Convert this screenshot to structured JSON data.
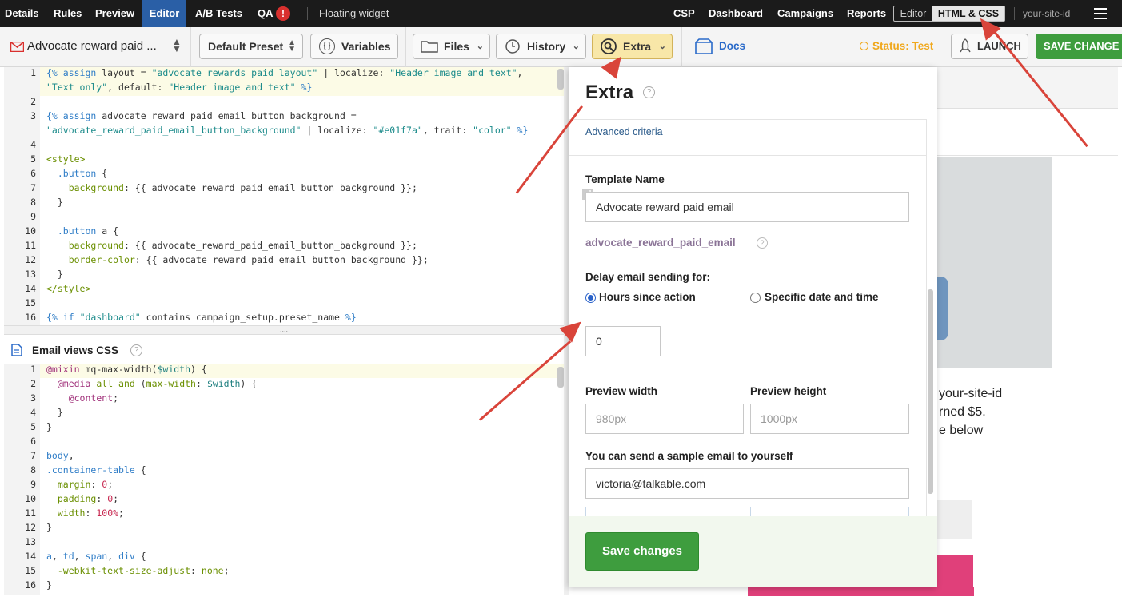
{
  "topbar": {
    "tabs": [
      "Details",
      "Rules",
      "Preview",
      "Editor",
      "A/B Tests",
      "QA"
    ],
    "qa_badge": "!",
    "widget": "Floating widget",
    "right_links": [
      "CSP",
      "Dashboard",
      "Campaigns",
      "Reports"
    ],
    "mode_editor": "Editor",
    "mode_html_css": "HTML & CSS",
    "site": "your-site-id"
  },
  "toolbar": {
    "template_name": "Advocate reward paid ...",
    "preset": "Default Preset",
    "variables": "Variables",
    "files": "Files",
    "history": "History",
    "extra": "Extra",
    "docs": "Docs",
    "status": "Status: Test",
    "launch": "LAUNCH",
    "save": "SAVE CHANGE"
  },
  "editor_top": {
    "line_numbers": [
      "1",
      "",
      "2",
      "3",
      "",
      "4",
      "5",
      "6",
      "7",
      "8",
      "9",
      "10",
      "11",
      "12",
      "13",
      "14",
      "15",
      "16"
    ]
  },
  "css_panel": {
    "title": "Email views CSS",
    "line_numbers": [
      "1",
      "2",
      "3",
      "4",
      "5",
      "6",
      "7",
      "8",
      "9",
      "10",
      "11",
      "12",
      "13",
      "14",
      "15",
      "16"
    ]
  },
  "extra_panel": {
    "title": "Extra",
    "advanced": "Advanced criteria",
    "template_name_label": "Template Name",
    "template_name_value": "Advocate reward paid email",
    "template_slug": "advocate_reward_paid_email",
    "delay_label": "Delay email sending for:",
    "radio_hours": "Hours since action",
    "radio_specific": "Specific date and time",
    "delay_value": "0",
    "preview_width_label": "Preview width",
    "preview_height_label": "Preview height",
    "preview_width_placeholder": "980px",
    "preview_height_placeholder": "1000px",
    "sample_label": "You can send a sample email to yourself",
    "sample_email": "victoria@talkable.com",
    "save_button": "Save changes"
  },
  "preview": {
    "line1": "your-site-id",
    "line2": "rned $5.",
    "line3": "e below"
  },
  "colors": {
    "nav_active": "#2a5fa6",
    "save_green": "#3e9d3e",
    "status": "#f0a81c",
    "arrow": "#d9443a",
    "pink": "#e0407a"
  }
}
